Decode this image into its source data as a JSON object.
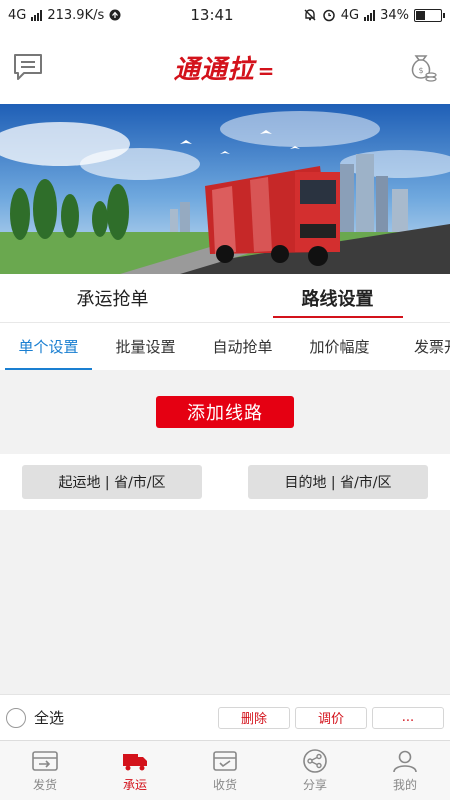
{
  "status_bar": {
    "network": "4G",
    "speed": "213.9K/s",
    "time": "13:41",
    "network_right": "4G",
    "battery": "34%",
    "battery_level": 0.34
  },
  "header": {
    "logo_text": "通通拉",
    "logo_tail": "=",
    "left_icon": "message-icon",
    "right_icon": "money-bag-icon",
    "brand_color": "#d3121b"
  },
  "main_tabs": [
    {
      "label": "承运抢单",
      "active": false
    },
    {
      "label": "路线设置",
      "active": true
    }
  ],
  "sub_tabs": [
    {
      "label": "单个设置",
      "active": true
    },
    {
      "label": "批量设置"
    },
    {
      "label": "自动抢单"
    },
    {
      "label": "加价幅度"
    },
    {
      "label": "发票开"
    }
  ],
  "add_route_label": "添加线路",
  "filters": {
    "origin": "起运地 | 省/市/区",
    "destination": "目的地 | 省/市/区"
  },
  "action_bar": {
    "select_all": "全选",
    "delete": "删除",
    "adjust_price": "调价",
    "more": "..."
  },
  "bottom_nav": [
    {
      "label": "发货",
      "icon": "ship-goods-icon"
    },
    {
      "label": "承运",
      "icon": "truck-icon",
      "active": true
    },
    {
      "label": "收货",
      "icon": "receive-box-icon"
    },
    {
      "label": "分享",
      "icon": "share-icon"
    },
    {
      "label": "我的",
      "icon": "user-icon"
    }
  ],
  "colors": {
    "accent_red": "#e50012",
    "tab_blue": "#1a7fd1"
  }
}
